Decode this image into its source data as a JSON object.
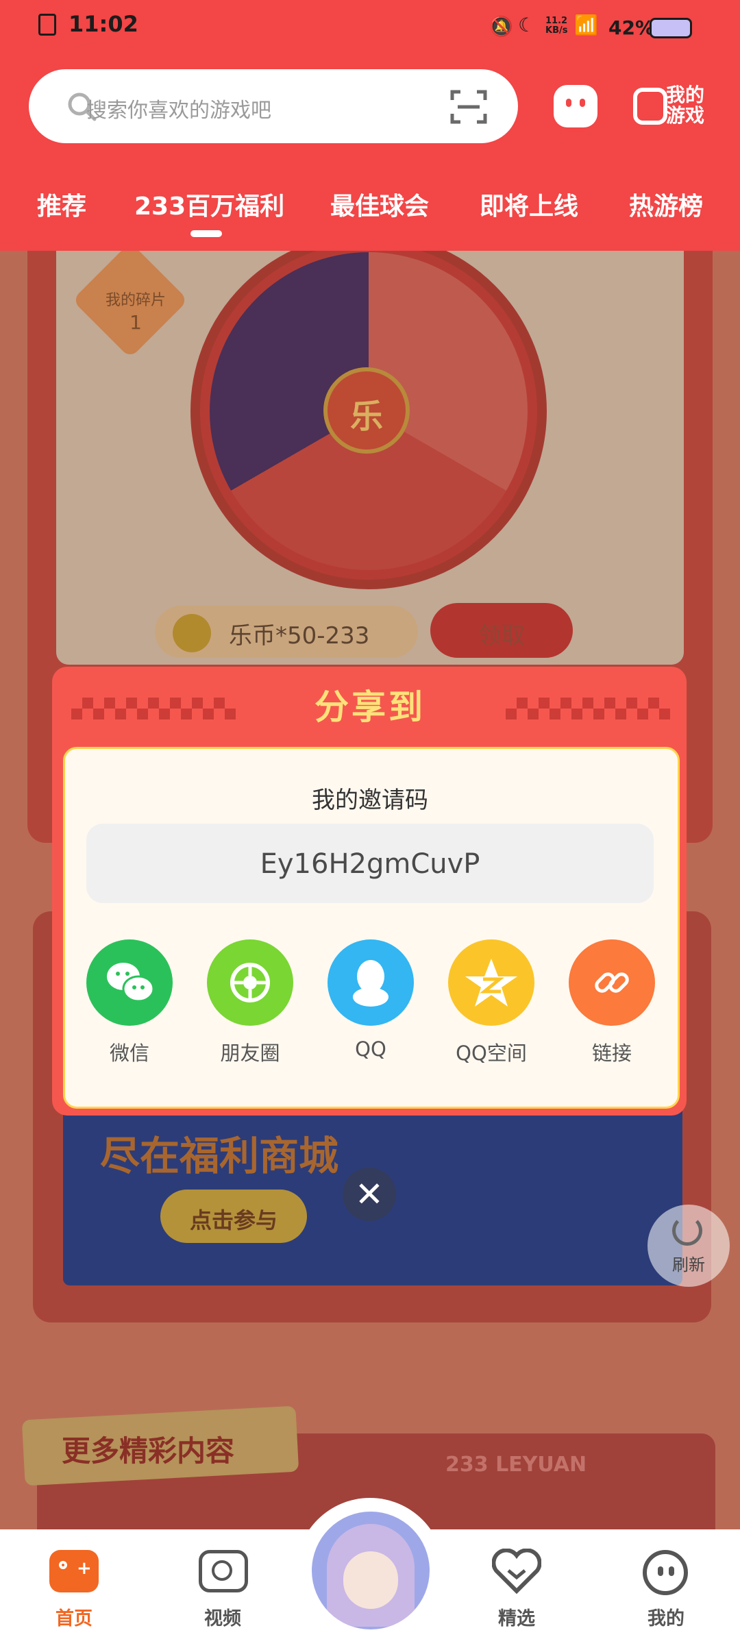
{
  "status_bar": {
    "time": "11:02",
    "net_speed": "11.2 KB/s",
    "battery": "42%"
  },
  "search": {
    "placeholder": "搜索你喜欢的游戏吧"
  },
  "header": {
    "my_games_label": "我的\n游戏"
  },
  "tabs": [
    {
      "label": "推荐"
    },
    {
      "label": "233百万福利"
    },
    {
      "label": "最佳球会"
    },
    {
      "label": "即将上线"
    },
    {
      "label": "热游榜"
    }
  ],
  "background": {
    "fragments_label": "我的碎片",
    "fragments_count": "1",
    "wheel_center": "乐",
    "reward_text": "乐币*50-233",
    "claim_button": "领取",
    "banner_line1": "尽在福利商城",
    "banner_cta": "点击参与",
    "section_title": "更多精彩内容",
    "section_tag": "233 LEYUAN"
  },
  "share_dialog": {
    "title": "分享到",
    "invite_label": "我的邀请码",
    "invite_code": "Ey16H2gmCuvP",
    "targets": [
      {
        "label": "微信",
        "color": "#2bc15a",
        "icon": "wechat-icon"
      },
      {
        "label": "朋友圈",
        "color": "#7ad633",
        "icon": "moments-icon"
      },
      {
        "label": "QQ",
        "color": "#33b6f2",
        "icon": "qq-icon"
      },
      {
        "label": "QQ空间",
        "color": "#fbc529",
        "icon": "qzone-icon"
      },
      {
        "label": "链接",
        "color": "#fb7a3c",
        "icon": "link-icon"
      }
    ]
  },
  "refresh_label": "刷新",
  "bottom_nav": [
    {
      "label": "首页",
      "active": true
    },
    {
      "label": "视频"
    },
    {
      "label": "精选"
    },
    {
      "label": "我的"
    }
  ],
  "colors": {
    "brand_red": "#f24647",
    "active_orange": "#f26722"
  }
}
